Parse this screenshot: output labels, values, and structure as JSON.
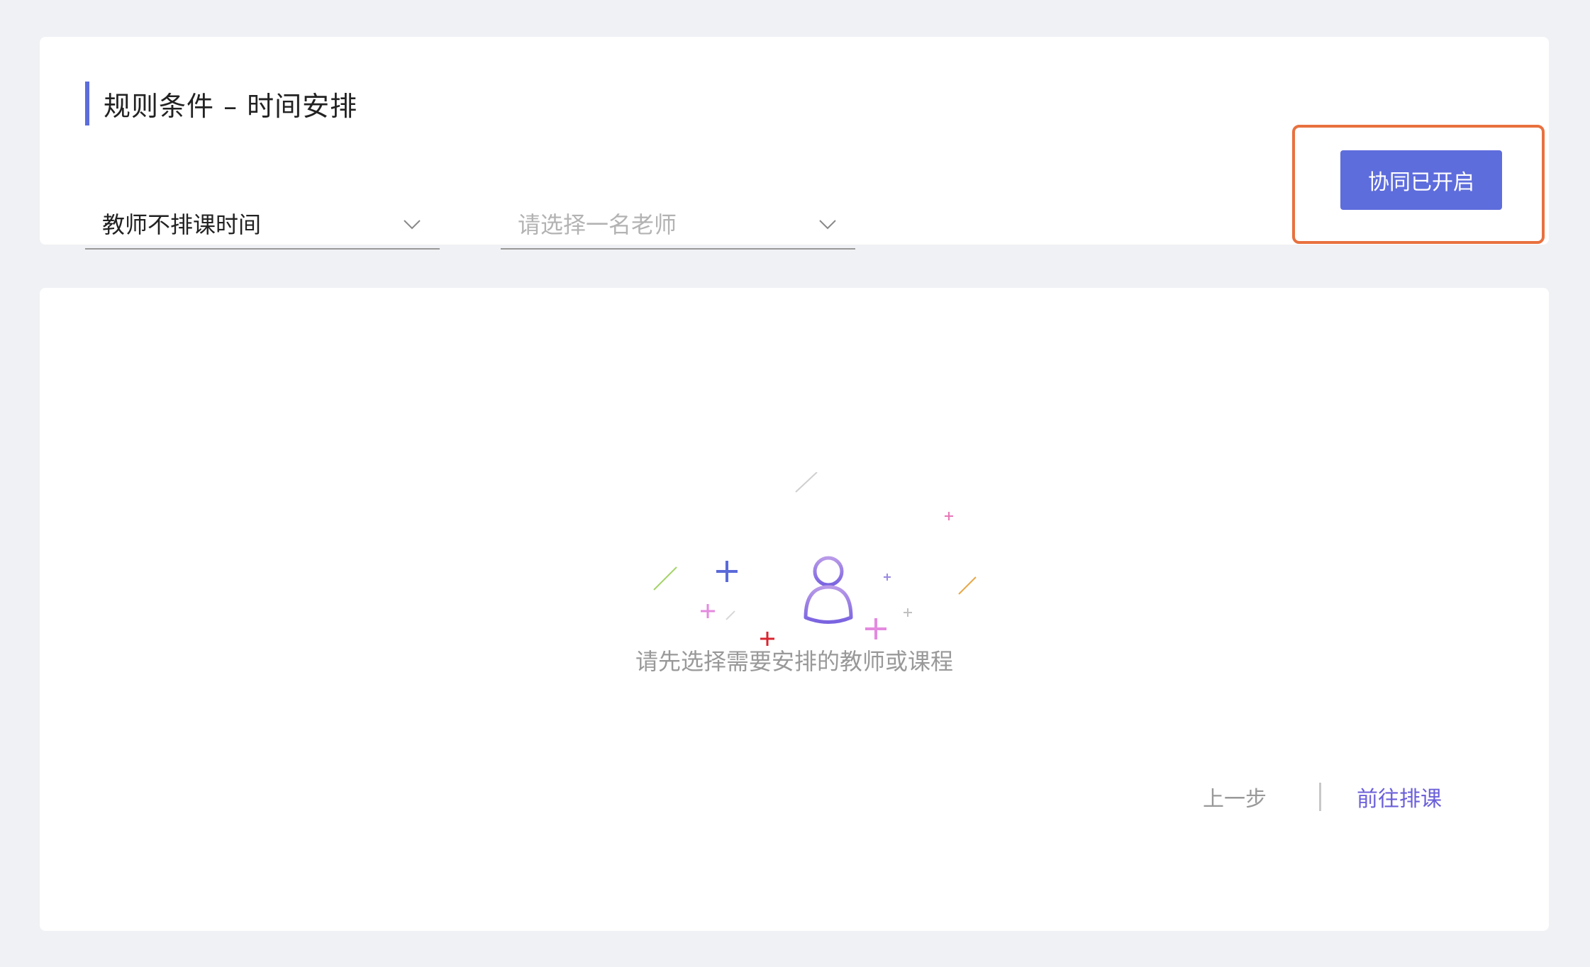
{
  "header": {
    "title": "规则条件 – 时间安排",
    "accent_color": "#5c6cdc"
  },
  "filters": {
    "type_select": {
      "value": "教师不排课时间",
      "icon": "chevron-down-icon"
    },
    "teacher_select": {
      "placeholder": "请选择一名老师",
      "icon": "chevron-down-icon"
    }
  },
  "collab_button": {
    "label": "协同已开启",
    "color": "#5e6ddc",
    "highlight_color": "#e8713f"
  },
  "empty_state": {
    "icon": "user-icon",
    "message": "请先选择需要安排的教师或课程"
  },
  "footer": {
    "prev_label": "上一步",
    "next_label": "前往排课",
    "next_color": "#6b5fd9"
  }
}
